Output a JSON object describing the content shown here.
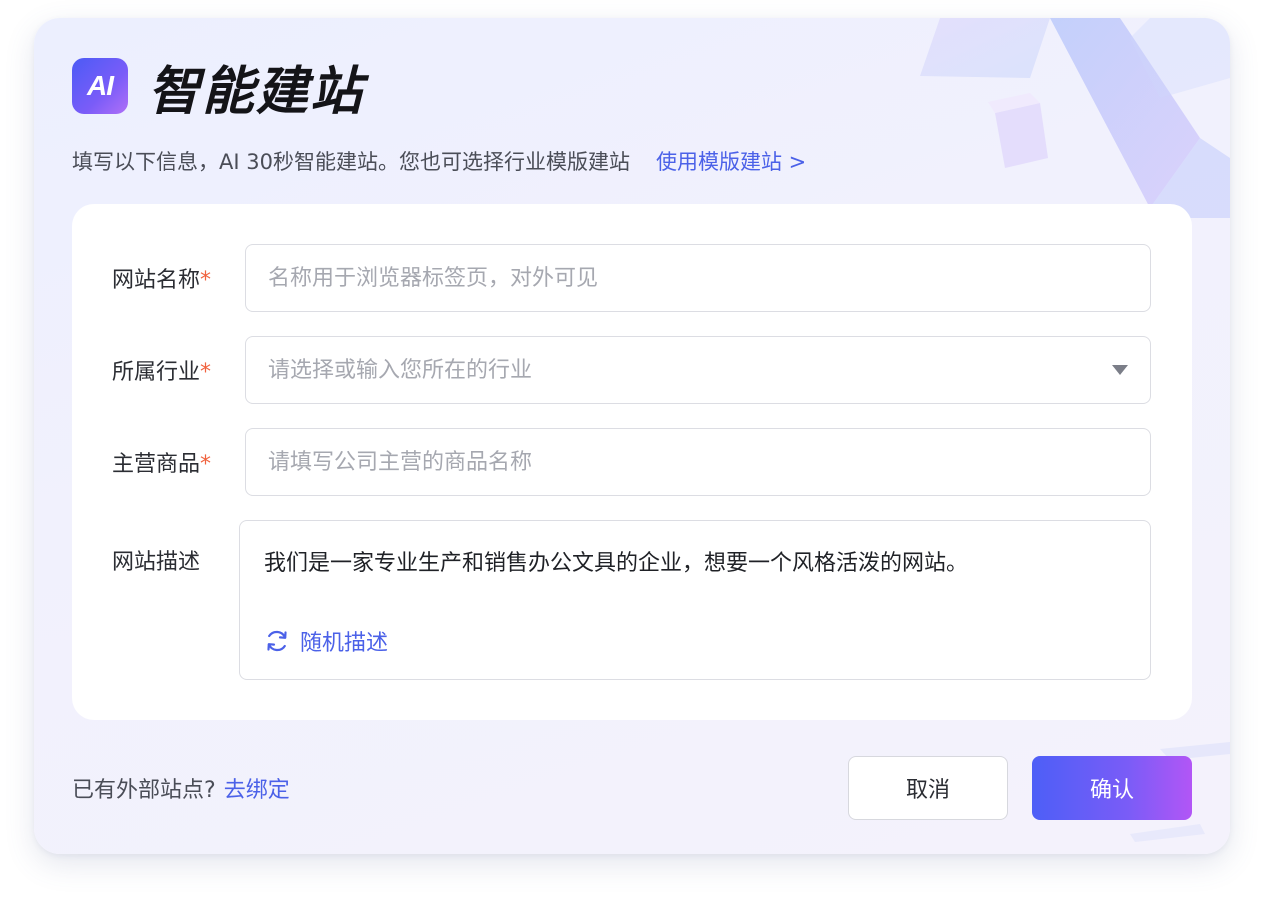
{
  "header": {
    "logo_text": "AI",
    "title": "智能建站"
  },
  "subtitle": {
    "text": "填写以下信息，AI 30秒智能建站。您也可选择行业模版建站",
    "template_link": "使用模版建站 >"
  },
  "form": {
    "site_name": {
      "label": "网站名称",
      "required_mark": "*",
      "placeholder": "名称用于浏览器标签页，对外可见"
    },
    "industry": {
      "label": "所属行业",
      "required_mark": "*",
      "placeholder": "请选择或输入您所在的行业"
    },
    "products": {
      "label": "主营商品",
      "required_mark": "*",
      "placeholder": "请填写公司主营的商品名称"
    },
    "description": {
      "label": "网站描述",
      "value": "我们是一家专业生产和销售办公文具的企业，想要一个风格活泼的网站。",
      "random_label": "随机描述"
    }
  },
  "footer": {
    "external_text": "已有外部站点?",
    "bind_link": "去绑定",
    "cancel_label": "取消",
    "confirm_label": "确认"
  },
  "colors": {
    "accent": "#4b61e8",
    "required": "#f0623e",
    "confirm_gradient_start": "#4d5ff7",
    "confirm_gradient_end": "#b256f6"
  },
  "icons": {
    "logo": "ai-logo-icon",
    "dropdown": "caret-down-icon",
    "random": "refresh-icon"
  }
}
